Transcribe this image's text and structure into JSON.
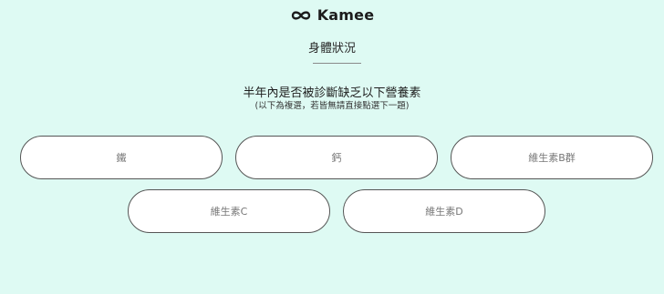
{
  "brand": {
    "name": "Kamee",
    "icon": "infinity-logo-icon"
  },
  "section": {
    "title": "身體狀況"
  },
  "question": {
    "text": "半年內是否被診斷缺乏以下營養素",
    "hint": "(以下為複選，若皆無請直接點選下一題)"
  },
  "options": [
    {
      "label": "鐵"
    },
    {
      "label": "鈣"
    },
    {
      "label": "維生素B群"
    },
    {
      "label": "維生素C"
    },
    {
      "label": "維生素D"
    }
  ],
  "colors": {
    "background": "#defaf3",
    "option_bg": "#ffffff",
    "option_border": "#555555",
    "option_text": "#777777"
  }
}
